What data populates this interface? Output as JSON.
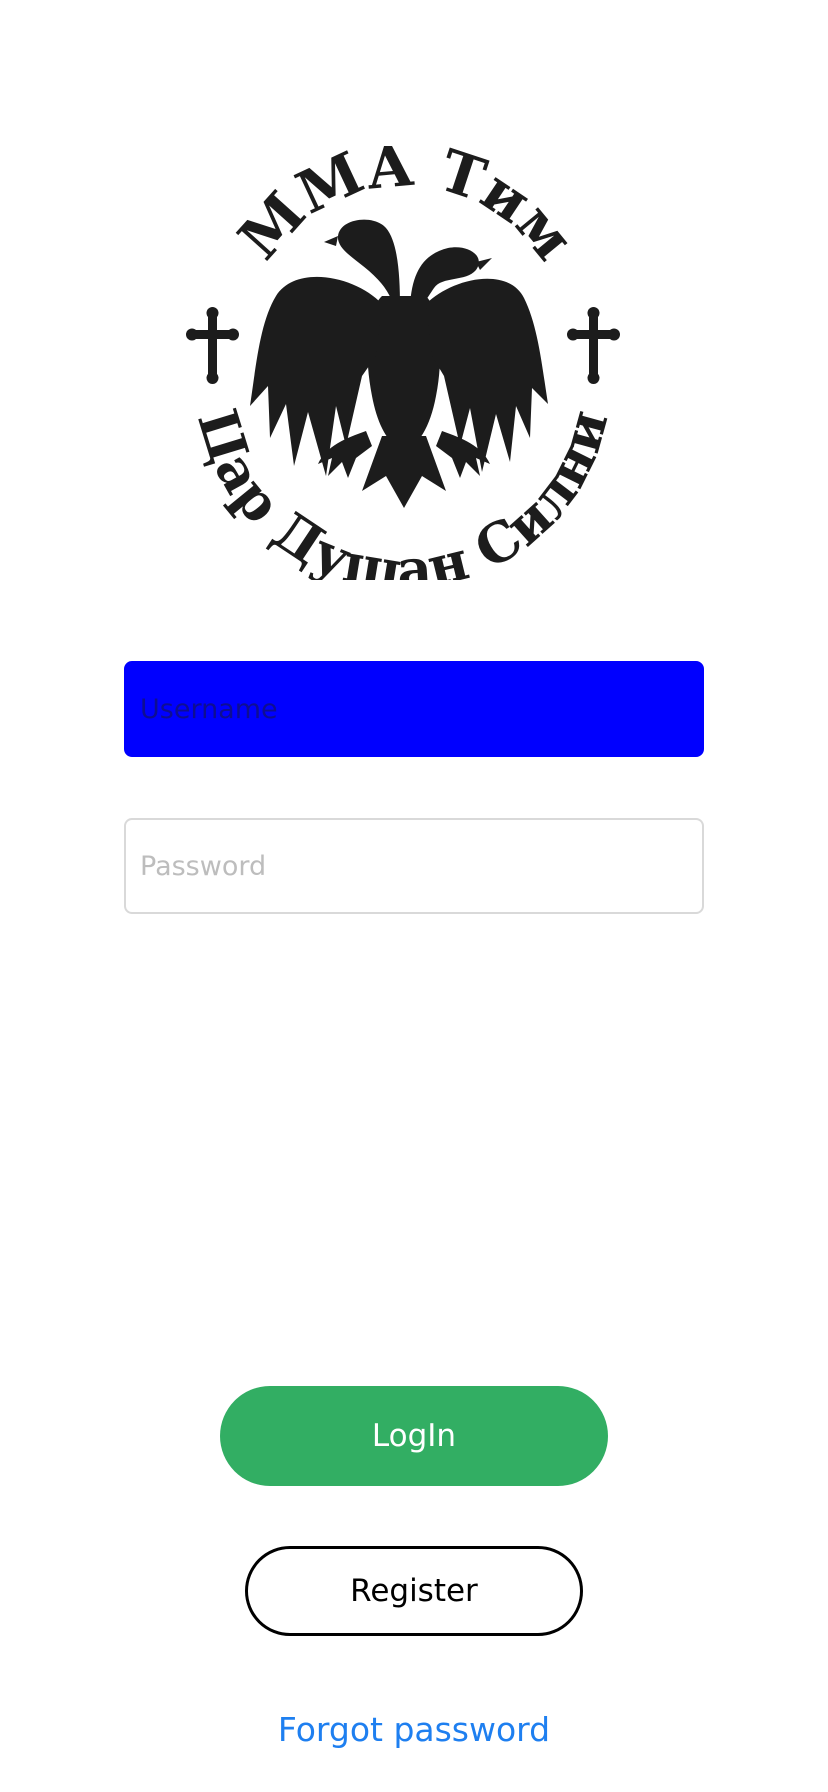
{
  "logo": {
    "top_text": "ММА Тим",
    "bottom_text": "Цар Душан Силни",
    "icon": "double-headed-eagle"
  },
  "form": {
    "username_placeholder": "Username",
    "username_value": "",
    "password_placeholder": "Password",
    "password_value": ""
  },
  "actions": {
    "login_label": "LogIn",
    "register_label": "Register",
    "forgot_label": "Forgot password"
  },
  "colors": {
    "username_bg": "#0000ff",
    "login_bg": "#32ae63",
    "link": "#1e7ff0",
    "logo": "#1c1c1c"
  }
}
